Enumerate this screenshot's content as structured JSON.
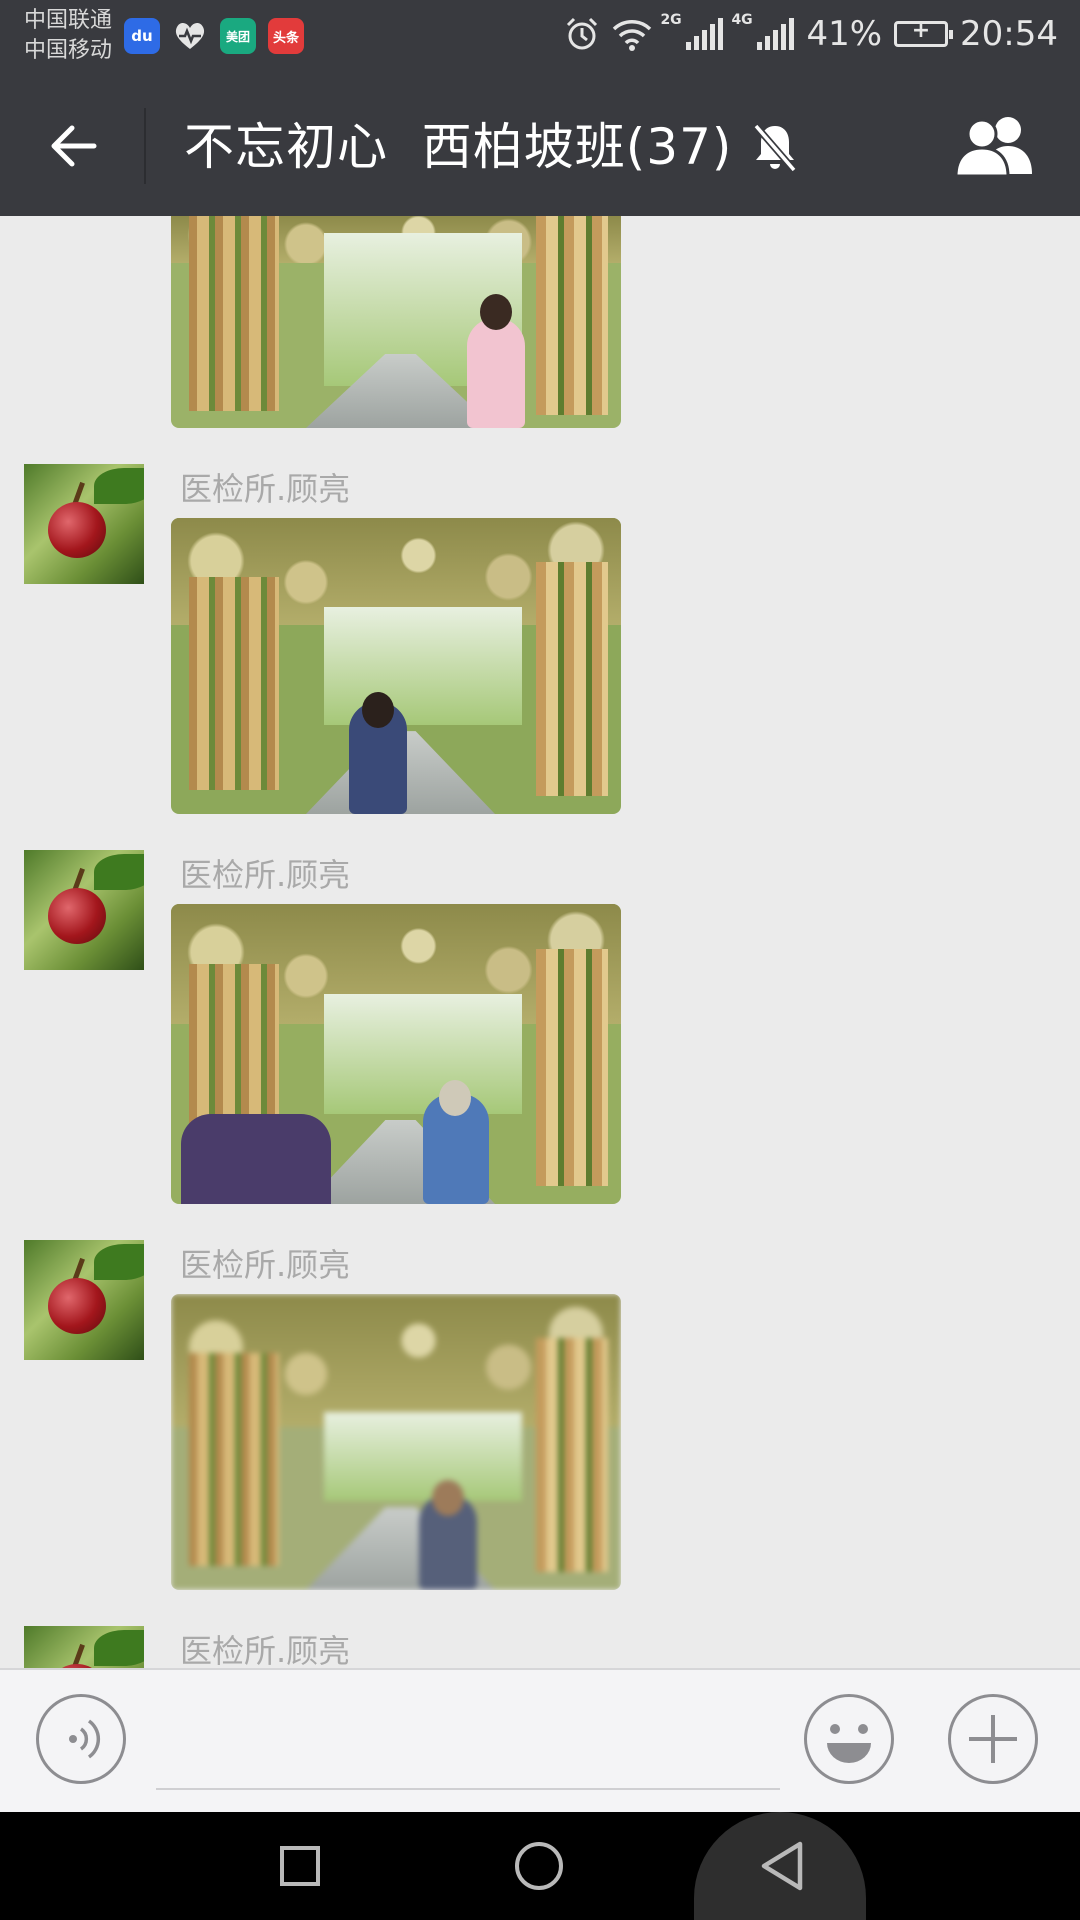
{
  "status_bar": {
    "carrier_1": "中国联通",
    "carrier_2": "中国移动",
    "apps": [
      {
        "icon": "baidu-icon",
        "label": "du",
        "color": "#2e6be6"
      },
      {
        "icon": "health-heart-icon",
        "label": "",
        "color": "#6a6b70"
      },
      {
        "icon": "meituan-icon",
        "label": "美团",
        "color": "#1aa980"
      },
      {
        "icon": "toutiao-icon",
        "label": "头条",
        "color": "#e23b3b"
      }
    ],
    "network_1": "2G",
    "network_2": "4G",
    "battery": "41%",
    "time": "20:54"
  },
  "header": {
    "title": "不忘初心  西柏坡班(37)",
    "colors": {
      "bar": "#393a3f",
      "text": "#ffffff"
    }
  },
  "chat": {
    "background": "#ebebeb",
    "messages": [
      {
        "sender": "",
        "type": "image",
        "image": "partial photo: woman with sunglasses under gourd trellis"
      },
      {
        "sender": "医检所.顾亮",
        "type": "image",
        "image": "woman in blue dress under gourd trellis corridor"
      },
      {
        "sender": "医检所.顾亮",
        "type": "image",
        "image": "woman in hat and sunglasses with crowd under trellis"
      },
      {
        "sender": "医检所.顾亮",
        "type": "image",
        "image": "blurred photo of woman under gourd trellis"
      },
      {
        "sender": "医检所.顾亮",
        "type": "image",
        "image": ""
      }
    ]
  },
  "input_bar": {
    "voice_icon": "voice-icon",
    "emoji_icon": "emoji-icon",
    "plus_icon": "plus-icon"
  }
}
